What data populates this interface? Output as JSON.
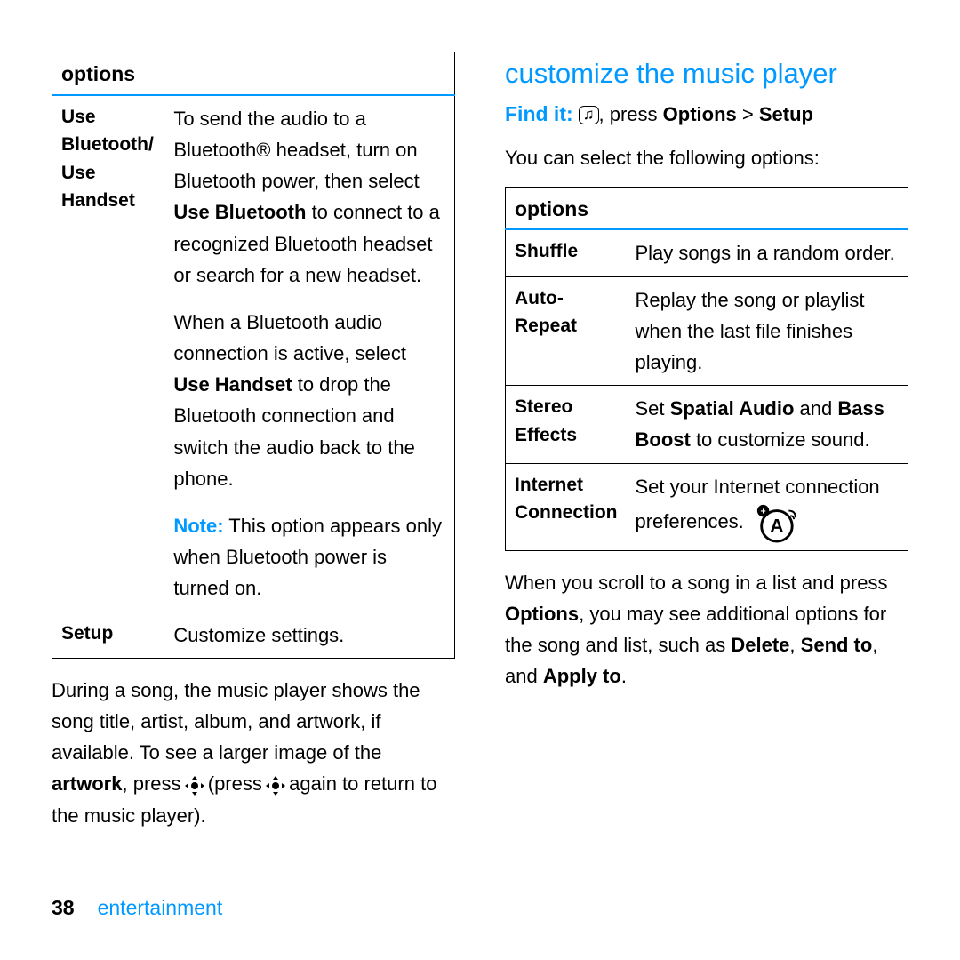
{
  "left": {
    "options_header": "options",
    "bt_label_a": "Use Bluetooth/",
    "bt_label_b": "Use Handset",
    "bt_p1_a": "To send the audio to a Bluetooth® headset, turn on Bluetooth power, then select ",
    "bt_p1_bold": "Use Bluetooth",
    "bt_p1_b": " to connect to a recognized Bluetooth headset or search for a new headset.",
    "bt_p2_a": "When a Bluetooth audio connection is active, select ",
    "bt_p2_bold": "Use Handset",
    "bt_p2_b": " to drop the Bluetooth connection and switch the audio back to the phone.",
    "bt_note_label": "Note:",
    "bt_note_text": " This option appears only when Bluetooth power is turned on.",
    "setup_label": "Setup",
    "setup_desc": "Customize settings.",
    "para_a": "During a song, the music player shows the song title, artist, album, and artwork, if available. To see a larger image of the ",
    "para_bold": "artwork",
    "para_b": ", press ",
    "para_c": " (press ",
    "para_d": " again to return to the music player)."
  },
  "right": {
    "h2": "customize the music player",
    "findit_label": "Find it:",
    "findit_text_a": ", press ",
    "findit_opt": "Options",
    "findit_gt": ">",
    "findit_setup": "Setup",
    "lead": "You can select the following options:",
    "options_header": "options",
    "shuffle_label": "Shuffle",
    "shuffle_desc": "Play songs in a random order.",
    "repeat_label": "Auto- Repeat",
    "repeat_desc": "Replay the song or playlist when the last file finishes playing.",
    "stereo_label": "Stereo Effects",
    "stereo_a": "Set ",
    "stereo_b1": "Spatial Audio",
    "stereo_and": " and ",
    "stereo_b2": "Bass Boost",
    "stereo_c": " to customize sound.",
    "net_label_a": "Internet",
    "net_label_b": "Connection",
    "net_desc": "Set your Internet connection preferences.",
    "tail_a": "When you scroll to a song in a list and press ",
    "tail_opt": "Options",
    "tail_b": ", you may see additional options for the song and list, such as ",
    "tail_del": "Delete",
    "tail_c": ", ",
    "tail_send": "Send to",
    "tail_d": ", and ",
    "tail_apply": "Apply to",
    "tail_e": "."
  },
  "footer": {
    "page": "38",
    "section": "entertainment"
  }
}
